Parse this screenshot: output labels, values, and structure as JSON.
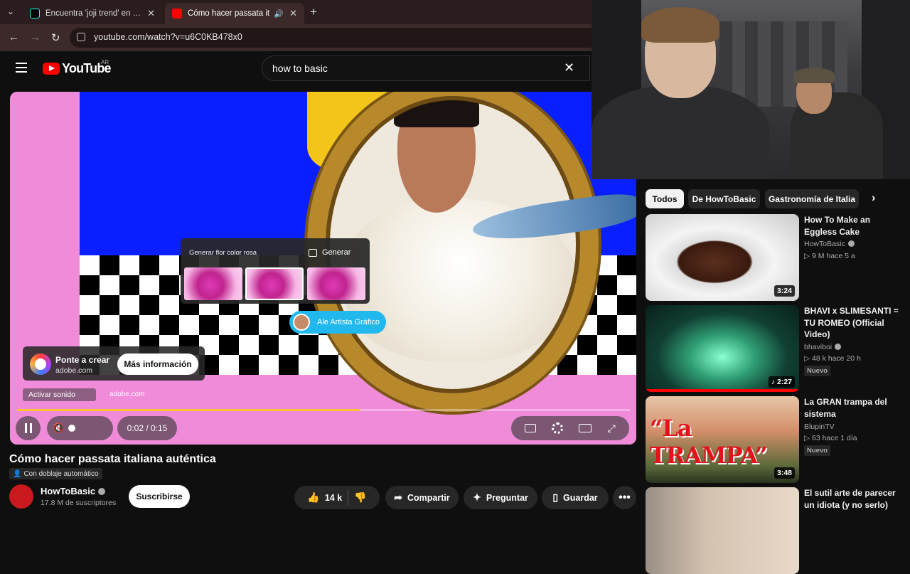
{
  "browser": {
    "tabs": [
      {
        "label": "Encuentra 'joji trend' en TikTok",
        "icon": "tiktok-icon",
        "close": "✕"
      },
      {
        "label": "Cómo hacer passata italiana",
        "icon": "youtube-icon",
        "close": "✕",
        "active": true
      }
    ],
    "new_tab": "+",
    "tab_list": "⌄",
    "url": "youtube.com/watch?v=u6C0KB478x0",
    "nav": {
      "back": "←",
      "forward": "→",
      "reload": "↻"
    }
  },
  "header": {
    "logo_text": "YouTube",
    "region": "AR",
    "search_value": "how to basic",
    "clear": "✕"
  },
  "player": {
    "ad": {
      "gen_prompt": "Generar flor color rosa",
      "gen_button": "Generar",
      "artist_chip": "Ale Artista Gráfico",
      "title": "Ponte a crear",
      "domain": "adobe.com",
      "more_info": "Más información",
      "unmute": "Activar sonido",
      "domain_bottom": "adobe.com"
    },
    "progress_fraction": 0.56,
    "time": "0:02 / 0:15"
  },
  "video": {
    "title": "Cómo hacer passata italiana auténtica",
    "dub_badge": "Con doblaje automático",
    "channel": "HowToBasic",
    "subscribers": "17.8 M de suscriptores",
    "subscribe": "Suscribirse",
    "likes": "14 k",
    "share": "Compartir",
    "ask": "Preguntar",
    "save": "Guardar",
    "more": "•••"
  },
  "sidebar": {
    "chips": [
      "Todos",
      "De HowToBasic",
      "Gastronomía de Italia"
    ],
    "next": "›",
    "recs": [
      {
        "title": "How To Make an Eggless Cake",
        "channel": "HowToBasic",
        "meta": "▷ 9 M  hace 5 a",
        "duration": "3:24",
        "badge": ""
      },
      {
        "title": "BHAVI x SLIMESANTI = TU ROMEO (Official Video)",
        "channel": "bhaviboi",
        "meta": "▷ 48 k  hace 20 h",
        "duration": "♪ 2:27",
        "badge": "Nuevo"
      },
      {
        "title": "La GRAN trampa del sistema",
        "channel": "BlupinTV",
        "meta": "▷ 63  hace 1 día",
        "duration": "3:48",
        "badge": "Nuevo",
        "thumb_text": "“La TRAMPA”"
      },
      {
        "title": "El sutil arte de parecer un idiota (y no serlo)",
        "channel": "",
        "meta": "",
        "duration": "",
        "badge": ""
      }
    ]
  },
  "colors": {
    "accent": "#ff0000",
    "progress": "#f7c531",
    "background": "#0f0f0f"
  }
}
